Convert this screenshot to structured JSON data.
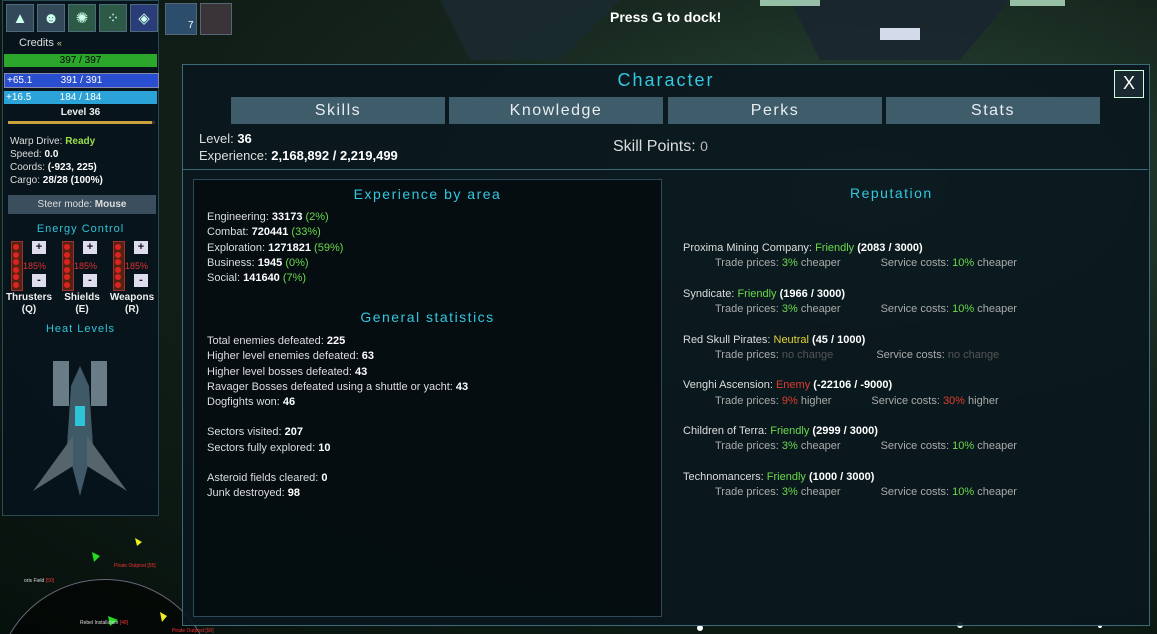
{
  "hud": {
    "credits_label": "Credits",
    "credits_symbol": "«",
    "hull": "397 / 397",
    "shield_regen": "+65.1",
    "shield": "391 / 391",
    "energy_regen": "+16.5",
    "energy": "184 / 184",
    "level_label": "Level 36",
    "xp_fraction": 0.98,
    "warp_label": "Warp Drive:",
    "warp_value": "Ready",
    "speed_label": "Speed:",
    "speed_value": "0.0",
    "coords_label": "Coords:",
    "coords_value": "(-923, 225)",
    "cargo_label": "Cargo:",
    "cargo_value": "28/28 (100%)",
    "steer_label": "Steer mode:",
    "steer_value": "Mouse",
    "energy_control_title": "Energy Control",
    "heat_levels_title": "Heat Levels",
    "energy_groups": [
      {
        "pct": "185%",
        "label": "Thrusters",
        "key": "(Q)"
      },
      {
        "pct": "185%",
        "label": "Shields",
        "key": "(E)"
      },
      {
        "pct": "185%",
        "label": "Weapons",
        "key": "(R)"
      }
    ],
    "plus": "+",
    "minus": "-"
  },
  "top": {
    "dock_message": "Press G to dock!",
    "slot_count": "7"
  },
  "radar": {
    "labels": [
      "oris Field",
      "Pirate Outpost",
      "Rebel Installation",
      "Pirate Outpost"
    ],
    "counts": [
      "[50]",
      "[55]",
      "[48]",
      "[50]"
    ]
  },
  "panel": {
    "title": "Character",
    "close": "X",
    "tabs": [
      "Skills",
      "Knowledge",
      "Perks",
      "Stats"
    ],
    "level_label": "Level:",
    "level_value": "36",
    "exp_label": "Experience:",
    "exp_value": "2,168,892 / 2,219,499",
    "skill_points_label": "Skill Points:",
    "skill_points_value": "0"
  },
  "experience": {
    "title": "Experience by area",
    "rows": [
      {
        "label": "Engineering:",
        "value": "33173",
        "pct": "(2%)"
      },
      {
        "label": "Combat:",
        "value": "720441",
        "pct": "(33%)"
      },
      {
        "label": "Exploration:",
        "value": "1271821",
        "pct": "(59%)"
      },
      {
        "label": "Business:",
        "value": "1945",
        "pct": "(0%)"
      },
      {
        "label": "Social:",
        "value": "141640",
        "pct": "(7%)"
      }
    ]
  },
  "general": {
    "title": "General statistics",
    "groups": [
      [
        {
          "label": "Total enemies defeated:",
          "value": "225"
        },
        {
          "label": "Higher level enemies defeated:",
          "value": "63"
        },
        {
          "label": "Higher level bosses defeated:",
          "value": "43"
        },
        {
          "label": "Ravager Bosses defeated using a shuttle or yacht:",
          "value": "43"
        },
        {
          "label": "Dogfights won:",
          "value": "46"
        }
      ],
      [
        {
          "label": "Sectors visited:",
          "value": "207"
        },
        {
          "label": "Sectors fully explored:",
          "value": "10"
        }
      ],
      [
        {
          "label": "Asteroid fields cleared:",
          "value": "0"
        },
        {
          "label": "Junk destroyed:",
          "value": "98"
        }
      ]
    ]
  },
  "reputation": {
    "title": "Reputation",
    "trade_label": "Trade prices:",
    "service_label": "Service costs:",
    "factions": [
      {
        "name": "Proxima Mining Company:",
        "standing": "Friendly",
        "standing_class": "friendly",
        "score": "(2083 / 3000)",
        "trade": "3%",
        "trade_word": "cheaper",
        "trade_class": "good",
        "service": "10%",
        "service_word": "cheaper",
        "service_class": "good"
      },
      {
        "name": "Syndicate:",
        "standing": "Friendly",
        "standing_class": "friendly",
        "score": "(1966 / 3000)",
        "trade": "3%",
        "trade_word": "cheaper",
        "trade_class": "good",
        "service": "10%",
        "service_word": "cheaper",
        "service_class": "good"
      },
      {
        "name": "Red Skull Pirates:",
        "standing": "Neutral",
        "standing_class": "neutral",
        "score": "(45 / 1000)",
        "trade": "no change",
        "trade_word": "",
        "trade_class": "dim",
        "service": "no change",
        "service_word": "",
        "service_class": "dim"
      },
      {
        "name": "Venghi Ascension:",
        "standing": "Enemy",
        "standing_class": "enemy",
        "score": "(-22106 / -9000)",
        "trade": "9%",
        "trade_word": "higher",
        "trade_class": "bad",
        "service": "30%",
        "service_word": "higher",
        "service_class": "bad"
      },
      {
        "name": "Children of Terra:",
        "standing": "Friendly",
        "standing_class": "friendly",
        "score": "(2999 / 3000)",
        "trade": "3%",
        "trade_word": "cheaper",
        "trade_class": "good",
        "service": "10%",
        "service_word": "cheaper",
        "service_class": "good"
      },
      {
        "name": "Technomancers:",
        "standing": "Friendly",
        "standing_class": "friendly",
        "score": "(1000 / 3000)",
        "trade": "3%",
        "trade_word": "cheaper",
        "trade_class": "good",
        "service": "10%",
        "service_word": "cheaper",
        "service_class": "good"
      }
    ]
  }
}
